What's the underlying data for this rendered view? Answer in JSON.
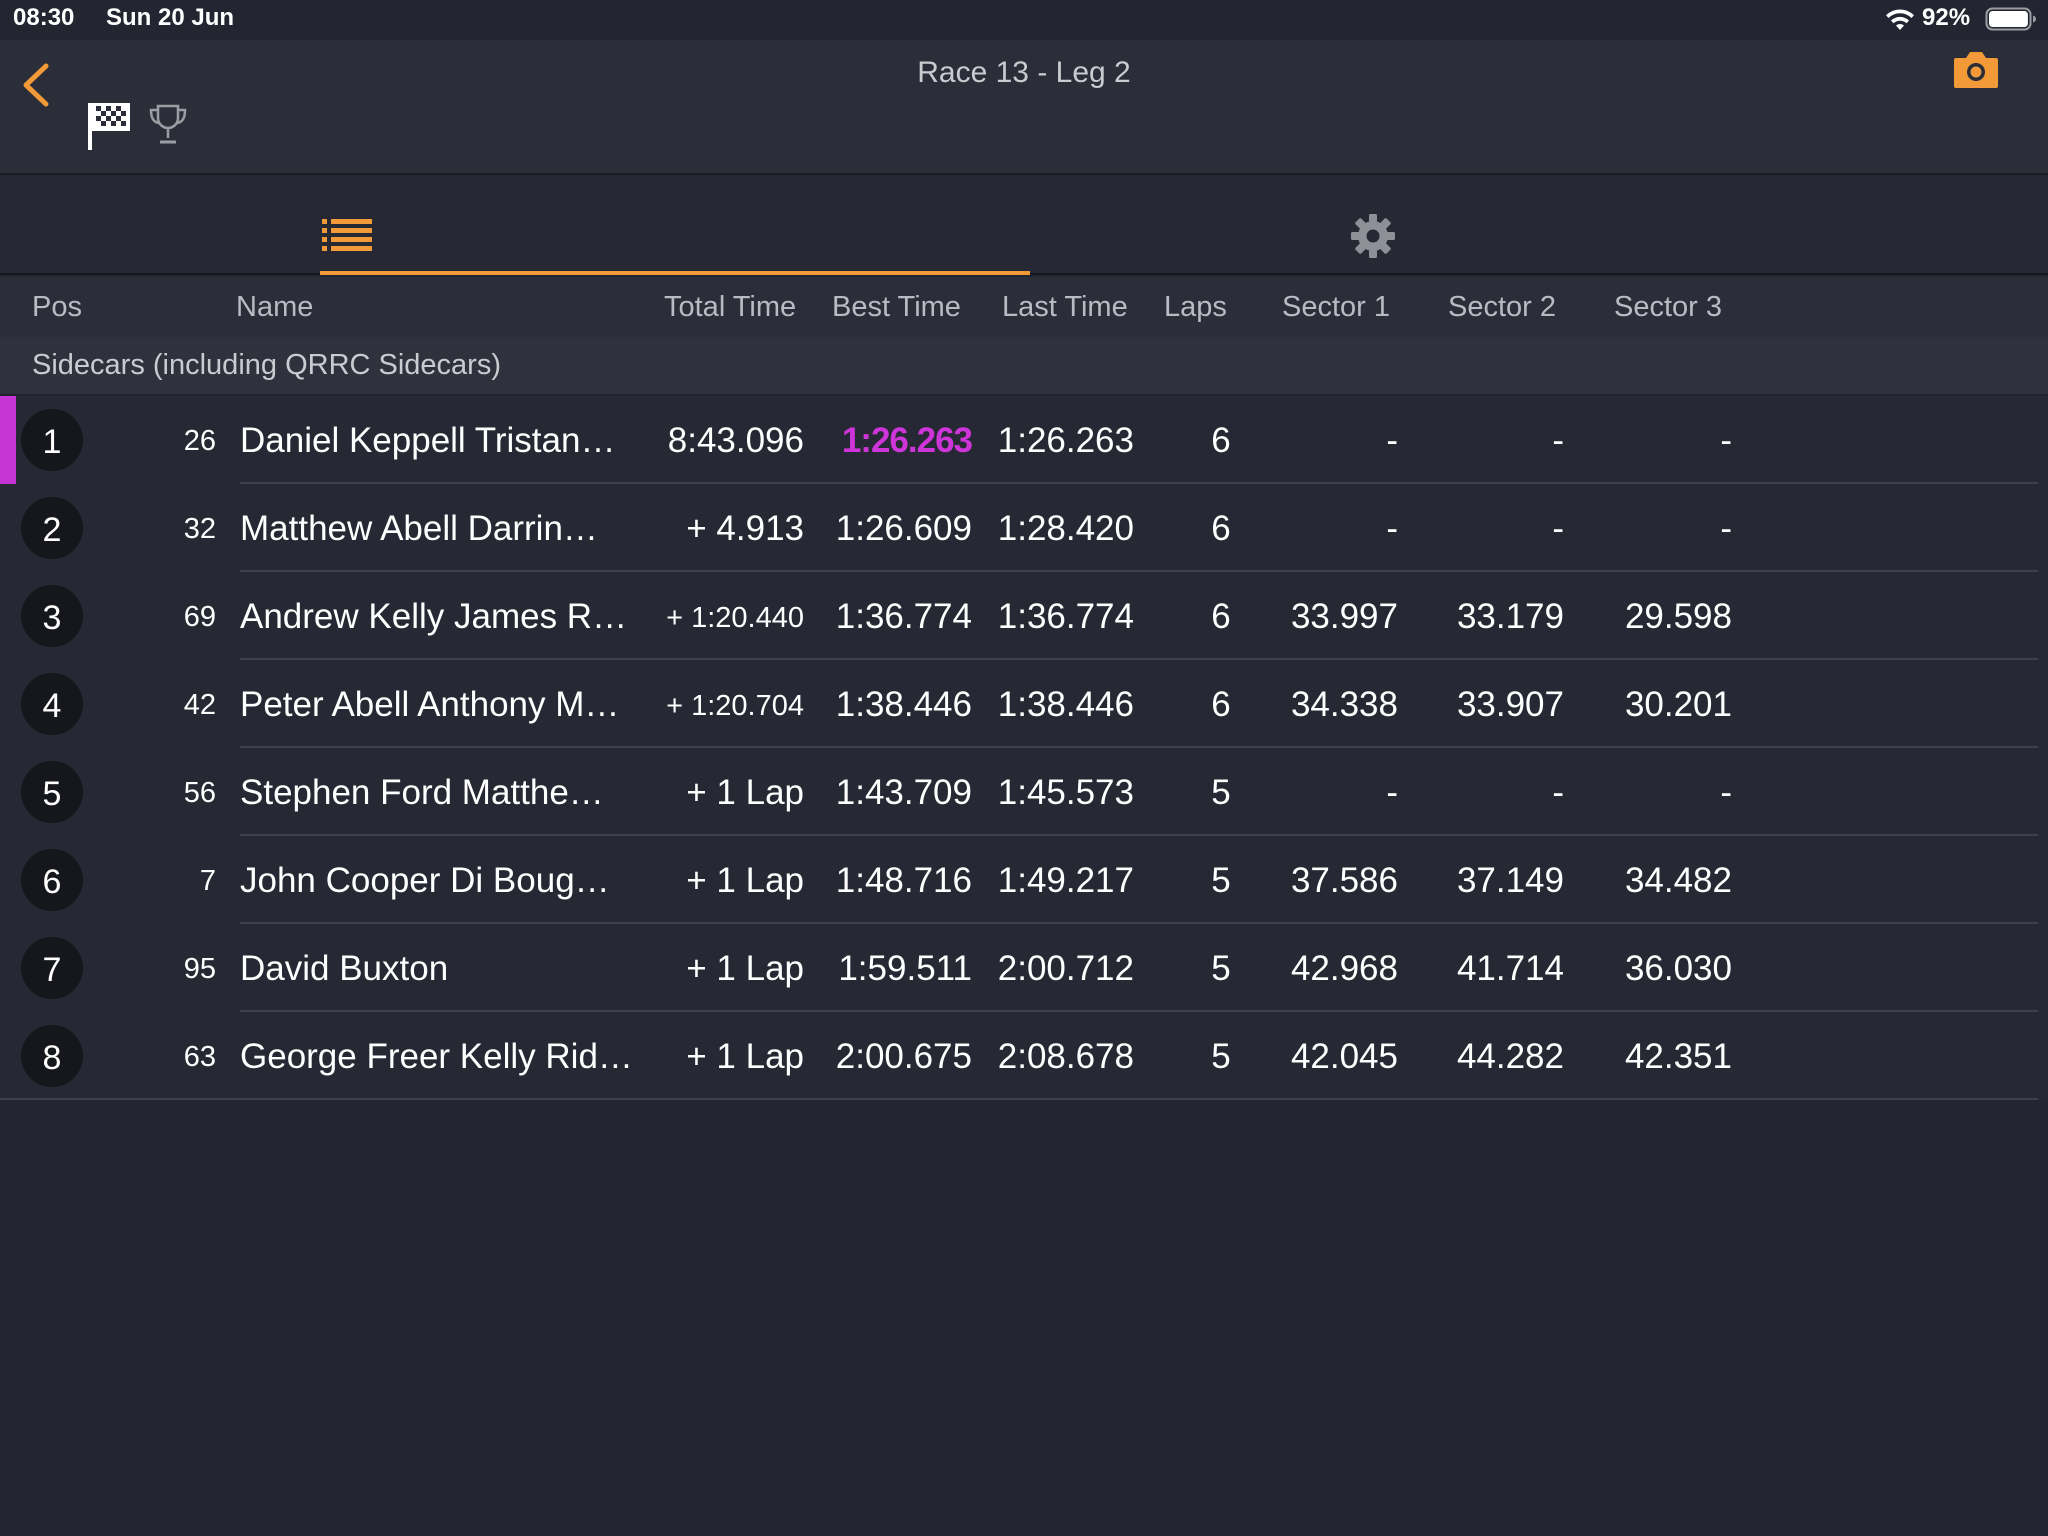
{
  "status_bar": {
    "time": "08:30",
    "date": "Sun 20 Jun",
    "battery_percent": "92%",
    "battery_level": 0.92
  },
  "nav": {
    "title": "Race 13 -  Leg 2",
    "accent_color": "#f29a38"
  },
  "tabs": {
    "active": "list",
    "items": [
      "list-icon",
      "gear-icon"
    ]
  },
  "columns": {
    "pos": "Pos",
    "name": "Name",
    "total": "Total Time",
    "best": "Best Time",
    "last": "Last Time",
    "laps": "Laps",
    "s1": "Sector 1",
    "s2": "Sector 2",
    "s3": "Sector 3"
  },
  "category": "Sidecars (including QRRC Sidecars)",
  "colors": {
    "fastest": "#cd35d9",
    "accent": "#f29a38"
  },
  "rows": [
    {
      "pos": "1",
      "num": "26",
      "name": "Daniel Keppell Tristan…",
      "total": "8:43.096",
      "best": "1:26.263",
      "last": "1:26.263",
      "laps": "6",
      "s1": "-",
      "s2": "-",
      "s3": "-"
    },
    {
      "pos": "2",
      "num": "32",
      "name": "Matthew Abell Darrin…",
      "total": "+ 4.913",
      "best": "1:26.609",
      "last": "1:28.420",
      "laps": "6",
      "s1": "-",
      "s2": "-",
      "s3": "-"
    },
    {
      "pos": "3",
      "num": "69",
      "name": "Andrew Kelly James R…",
      "total": "+ 1:20.440",
      "best": "1:36.774",
      "last": "1:36.774",
      "laps": "6",
      "s1": "33.997",
      "s2": "33.179",
      "s3": "29.598"
    },
    {
      "pos": "4",
      "num": "42",
      "name": "Peter Abell Anthony M…",
      "total": "+ 1:20.704",
      "best": "1:38.446",
      "last": "1:38.446",
      "laps": "6",
      "s1": "34.338",
      "s2": "33.907",
      "s3": "30.201"
    },
    {
      "pos": "5",
      "num": "56",
      "name": "Stephen Ford Matthe…",
      "total": "+ 1 Lap",
      "best": "1:43.709",
      "last": "1:45.573",
      "laps": "5",
      "s1": "-",
      "s2": "-",
      "s3": "-"
    },
    {
      "pos": "6",
      "num": "7",
      "name": "John Cooper Di Boug…",
      "total": "+ 1 Lap",
      "best": "1:48.716",
      "last": "1:49.217",
      "laps": "5",
      "s1": "37.586",
      "s2": "37.149",
      "s3": "34.482"
    },
    {
      "pos": "7",
      "num": "95",
      "name": "David Buxton",
      "total": "+ 1 Lap",
      "best": "1:59.511",
      "last": "2:00.712",
      "laps": "5",
      "s1": "42.968",
      "s2": "41.714",
      "s3": "36.030"
    },
    {
      "pos": "8",
      "num": "63",
      "name": "George Freer Kelly Rid…",
      "total": "+ 1 Lap",
      "best": "2:00.675",
      "last": "2:08.678",
      "laps": "5",
      "s1": "42.045",
      "s2": "44.282",
      "s3": "42.351"
    }
  ]
}
